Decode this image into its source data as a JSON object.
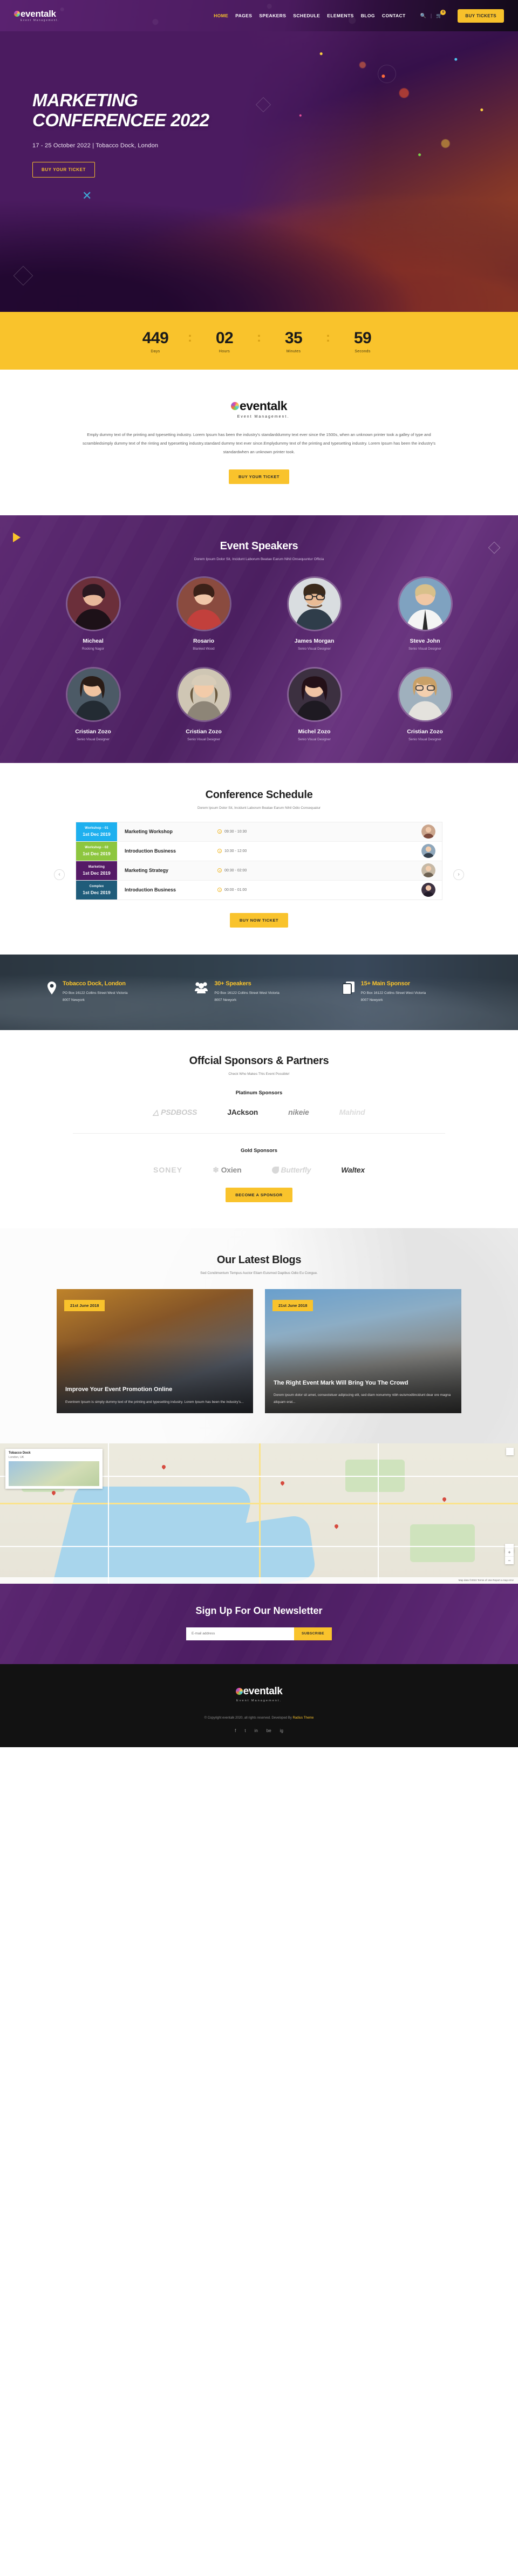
{
  "header": {
    "brand": {
      "name": "eventalk",
      "tagline": "Event Management."
    },
    "nav": [
      {
        "label": "HOME",
        "active": true
      },
      {
        "label": "PAGES",
        "active": false
      },
      {
        "label": "SPEAKERS",
        "active": false
      },
      {
        "label": "SCHEDULE",
        "active": false
      },
      {
        "label": "ELEMENTS",
        "active": false
      },
      {
        "label": "BLOG",
        "active": false
      },
      {
        "label": "CONTACT",
        "active": false
      }
    ],
    "search_icon": "search-icon",
    "cart_icon": "cart-icon",
    "cart_count": "0",
    "buy_button": "BUY TICKETS"
  },
  "hero": {
    "title_line1": "MARKETING",
    "title_line2": "CONFERENCEE 2022",
    "meta": "17 - 25 October 2022 | Tobacco Dock, London",
    "button": "BUY YOUR TICKET"
  },
  "countdown": {
    "items": [
      {
        "value": "449",
        "label": "Days"
      },
      {
        "value": "02",
        "label": "Hours"
      },
      {
        "value": "35",
        "label": "Minutes"
      },
      {
        "value": "59",
        "label": "Seconds"
      }
    ],
    "separator": ":"
  },
  "about": {
    "brand": "eventalk",
    "tagline": "Event Management.",
    "text": "Emply dummy text of the printing and typesetting industry. Lorem Ipsum has been the industry's standarddummy text ever since the 1500s, when an unknown printer took a galley of type and scrambledsimply dummy text of the rinting and typesetting industry.standard dummy text ever since.Emplydummy text of the printing and typesetting industry. Lorem Ipsum has been the industry's standardwhen an unknown printer took.",
    "button": "BUY YOUR TICKET"
  },
  "speakers": {
    "title": "Event Speakers",
    "subtitle": "Dorem Ipsum Dolor Sit, Incidunt Laborum Beatae Earum Nihil Onsequuntur Officia",
    "items": [
      {
        "name": "Micheal",
        "role": "Rocking Nagor"
      },
      {
        "name": "Rosario",
        "role": "Blanked Wood"
      },
      {
        "name": "James Morgan",
        "role": "Senio Visual Designer"
      },
      {
        "name": "Steve John",
        "role": "Senio Visual Designer"
      },
      {
        "name": "Cristian Zozo",
        "role": "Senio Visual Designer"
      },
      {
        "name": "Cristian Zozo",
        "role": "Senio Visual Designer"
      },
      {
        "name": "Michel Zozo",
        "role": "Senio Visual Designer"
      },
      {
        "name": "Cristian Zozo",
        "role": "Senio Visual Designer"
      }
    ]
  },
  "schedule": {
    "title": "Conference Schedule",
    "subtitle": "Dorem Ipsum Dolor Sit, Incidunt Laborum Beatae Earum Nihil Odio Consequatur",
    "prev_icon": "chevron-left-icon",
    "next_icon": "chevron-right-icon",
    "rows": [
      {
        "tag": "Workshop - 01",
        "date": "1st Dec 2019",
        "color": "#1eb0ef",
        "name": "Marketing Workshop",
        "time": "09:30 - 10:30"
      },
      {
        "tag": "Workshop - 02",
        "date": "1st Dec 2019",
        "color": "#8dc63f",
        "name": "Introduction Business",
        "time": "10:30 - 12:00"
      },
      {
        "tag": "Marketing",
        "date": "1st Dec 2019",
        "color": "#551a66",
        "name": "Marketing Strategy",
        "time": "00:30 - 02:00"
      },
      {
        "tag": "Complex",
        "date": "1st Dec 2019",
        "color": "#1f5c7a",
        "name": "Introduction Business",
        "time": "00:00 - 01:00"
      }
    ],
    "button": "BUY NOW TICKET"
  },
  "infobar": {
    "items": [
      {
        "icon": "location-pin-icon",
        "title": "Tobacco Dock, London",
        "line1": "PO Box 16122 Collins Street West Victoria",
        "line2": "8007 Newyork"
      },
      {
        "icon": "speakers-group-icon",
        "title": "30+ Speakers",
        "line1": "PO Box 16122 Collins Street West Victoria",
        "line2": "8007 Newyork"
      },
      {
        "icon": "sponsor-cards-icon",
        "title": "15+ Main Sponsor",
        "line1": "PO Box 16122 Collins Street West Victoria",
        "line2": "8007 Newyork"
      }
    ]
  },
  "sponsors": {
    "title": "Offcial Sponsors & Partners",
    "subtitle": "Check Who Makes This Event Possible!",
    "platinum_label": "Platinum Sponsors",
    "platinum": [
      "PSDBOSS",
      "JAckson",
      "nikeie",
      "Mahind"
    ],
    "gold_label": "Gold Sponsors",
    "gold": [
      "SONEY",
      "Oxien",
      "Butterfly",
      "Waltex"
    ],
    "button": "BECOME A SPONSOR"
  },
  "blogs": {
    "title": "Our Latest Blogs",
    "subtitle": "Sed Condimentum Tempus Auctor Etiam Euismod Dapibus Odio Eu Congue.",
    "posts": [
      {
        "date": "21st June 2018",
        "title": "Improve Your Event Promotion Online",
        "excerpt": "Eventrem Ipsum is simply dummy text of the printing and typesetting industry. Lorem Ipsum has been the industry's..."
      },
      {
        "date": "21st June 2018",
        "title": "The Right Event Mark Will Bring You The Crowd",
        "excerpt": "Dorem ipsum dolor sit amet, consectetuer adipiscing elit, sed diam nonummy nibh euismodtincidunt dear ore magna aliquam erat..."
      }
    ]
  },
  "map": {
    "card_title": "Tobacco Dock",
    "card_sub": "London, UK",
    "zoom_in": "+",
    "zoom_out": "−",
    "attribution": "Map data ©2022   Terms of Use   Report a map error"
  },
  "newsletter": {
    "title": "Sign Up For Our Newsletter",
    "placeholder": "E-mail address",
    "button": "SUBSCRIBE"
  },
  "footer": {
    "brand": "eventalk",
    "tagline": "Event Management.",
    "copyright": "© Copyright eventalk 2020, all rights reserved. Developed By ",
    "credit": "Radius Theme",
    "social": [
      "f",
      "t",
      "in",
      "be",
      "ig"
    ]
  }
}
